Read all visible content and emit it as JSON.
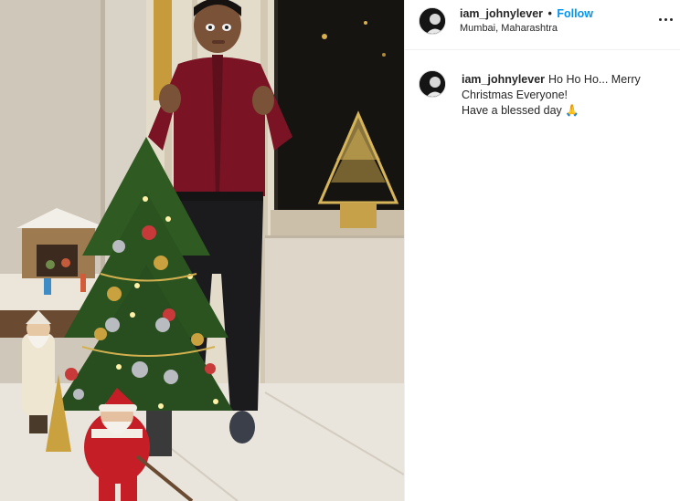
{
  "header": {
    "username": "iam_johnylever",
    "separator": "•",
    "follow_label": "Follow",
    "location": "Mumbai, Maharashtra",
    "more_icon": "more-horizontal-icon"
  },
  "caption": {
    "username": "iam_johnylever",
    "text": "Ho Ho Ho... Merry Christmas Everyone!\nHave a blessed day 🙏"
  },
  "photo": {
    "accent_colors": {
      "shirt": "#7a1424",
      "tree": "#2f5a22",
      "wall": "#d9d2c6"
    }
  }
}
